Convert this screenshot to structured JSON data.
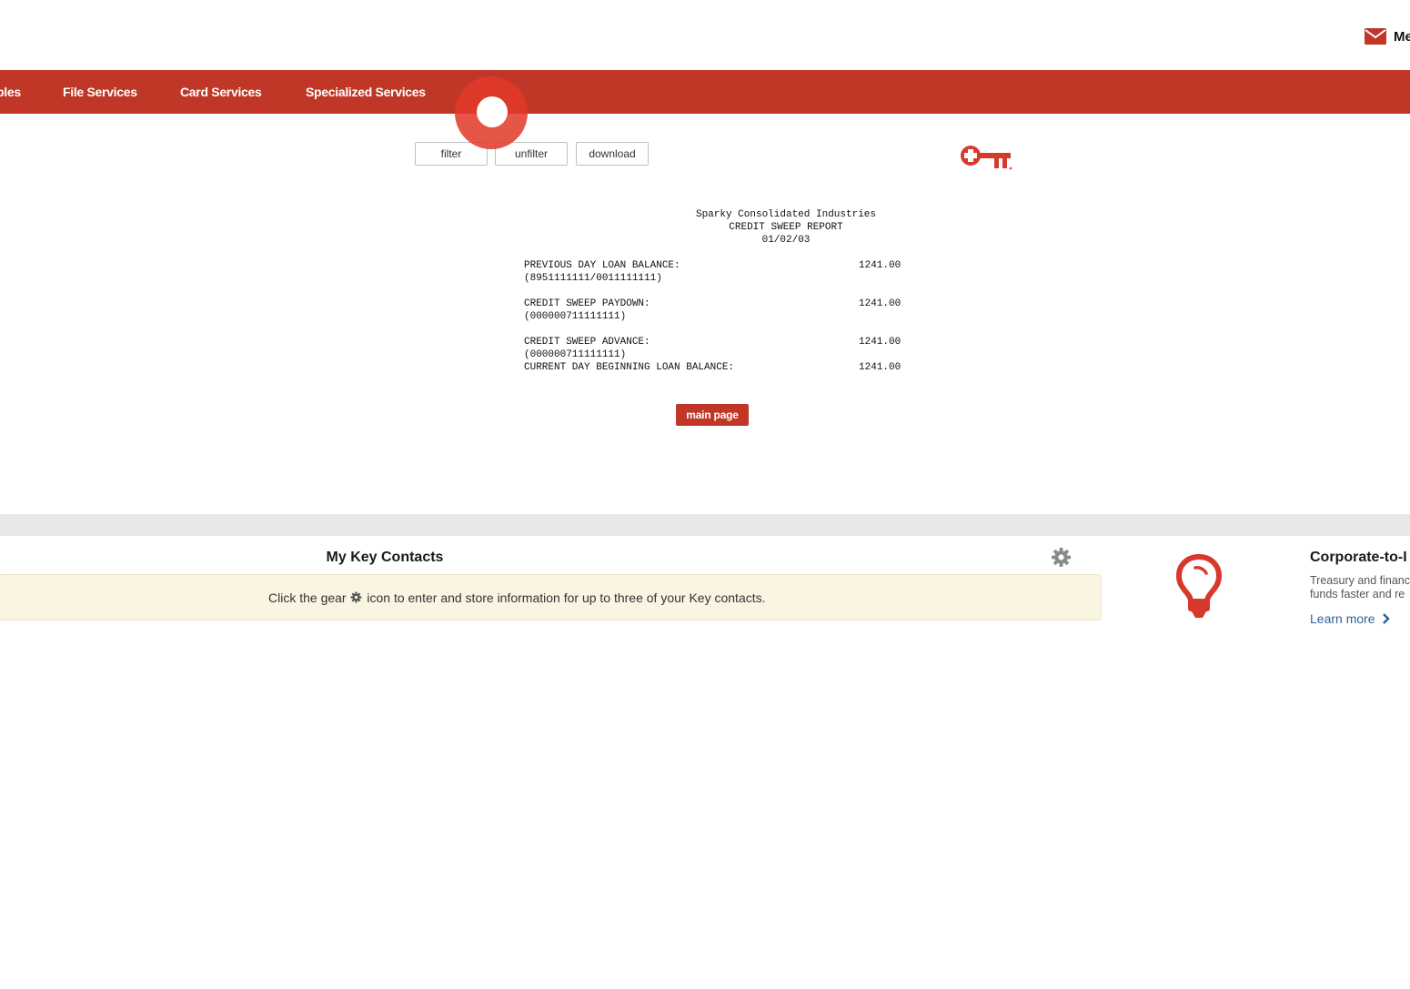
{
  "header": {
    "mail_label": "Me"
  },
  "nav": {
    "items": [
      {
        "label": "bles"
      },
      {
        "label": "File Services"
      },
      {
        "label": "Card Services"
      },
      {
        "label": "Specialized Services"
      }
    ]
  },
  "actions": {
    "filter": "filter",
    "unfilter": "unfilter",
    "download": "download"
  },
  "report": {
    "company": "Sparky Consolidated Industries",
    "title": "CREDIT SWEEP REPORT",
    "date": "01/02/03",
    "rows": [
      {
        "label": "PREVIOUS DAY LOAN BALANCE:",
        "sub": "(8951111111/0011111111)",
        "value": "1241.00"
      },
      {
        "label": "CREDIT SWEEP PAYDOWN:",
        "sub": "(000000711111111)",
        "value": "1241.00"
      },
      {
        "label": "CREDIT SWEEP ADVANCE:",
        "sub": "(000000711111111)",
        "value": "1241.00"
      },
      {
        "label": "CURRENT DAY BEGINNING LOAN BALANCE:",
        "sub": "",
        "value": "1241.00"
      }
    ],
    "main_page_label": "main page"
  },
  "contacts": {
    "title": "My Key Contacts",
    "note_before": "Click the gear",
    "note_after": "icon to enter and store information for up to three of your Key contacts."
  },
  "promo": {
    "title": "Corporate-to-I",
    "text": "Treasury and financ\nfunds faster and re",
    "link": "Learn more"
  },
  "colors": {
    "brand_red": "#c03728",
    "note_bg": "#faf4e2",
    "link_blue": "#2a6496"
  },
  "icons": [
    "mail-icon",
    "key-logo-icon",
    "gear-icon",
    "lightbulb-icon",
    "chevron-right-icon"
  ]
}
